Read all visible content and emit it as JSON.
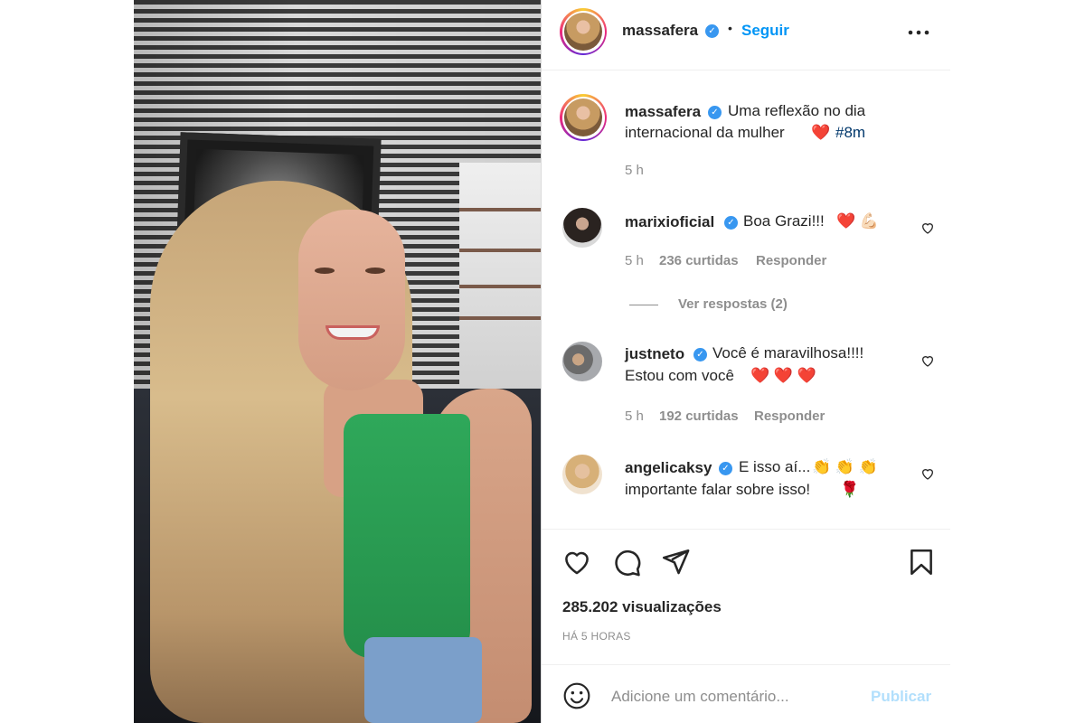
{
  "post": {
    "username": "massafera",
    "follow_label": "Seguir",
    "separator": "•"
  },
  "caption": {
    "username": "massafera",
    "text_line1": "Uma reflexão no dia",
    "text_line2": "internacional da mulher",
    "heart": "❤️",
    "hashtag": "#8m",
    "time": "5 h"
  },
  "comments": [
    {
      "username": "marixioficial",
      "text": "Boa Grazi!!!",
      "emojis": "❤️ 💪🏻",
      "time": "5 h",
      "likes": "236 curtidas",
      "reply_label": "Responder",
      "view_replies": "Ver respostas (2)"
    },
    {
      "username": "justneto",
      "text_line1": "Você é maravilhosa!!!!",
      "text_line2": "Estou com você",
      "emojis": "❤️ ❤️ ❤️",
      "time": "5 h",
      "likes": "192 curtidas",
      "reply_label": "Responder"
    },
    {
      "username": "angelicaksy",
      "text_line1": "E isso aí...",
      "emojis1": "👏 👏 👏",
      "text_line2": "importante falar sobre isso!",
      "emojis2": "🌹"
    }
  ],
  "stats": {
    "views": "285.202 visualizações",
    "time_ago": "HÁ 5 HORAS"
  },
  "comment_box": {
    "placeholder": "Adicione um comentário...",
    "publish_label": "Publicar"
  },
  "icons": {
    "more": "more-options-icon",
    "like": "heart-icon",
    "comment": "comment-icon",
    "share": "share-icon",
    "save": "bookmark-icon",
    "emoji": "emoji-icon",
    "verified": "verified-badge-icon"
  },
  "colors": {
    "link": "#0095f6",
    "verified": "#3897f0",
    "secondary_text": "#8e8e8e",
    "publish_disabled": "#b2dffc",
    "hashtag": "#00376b"
  }
}
